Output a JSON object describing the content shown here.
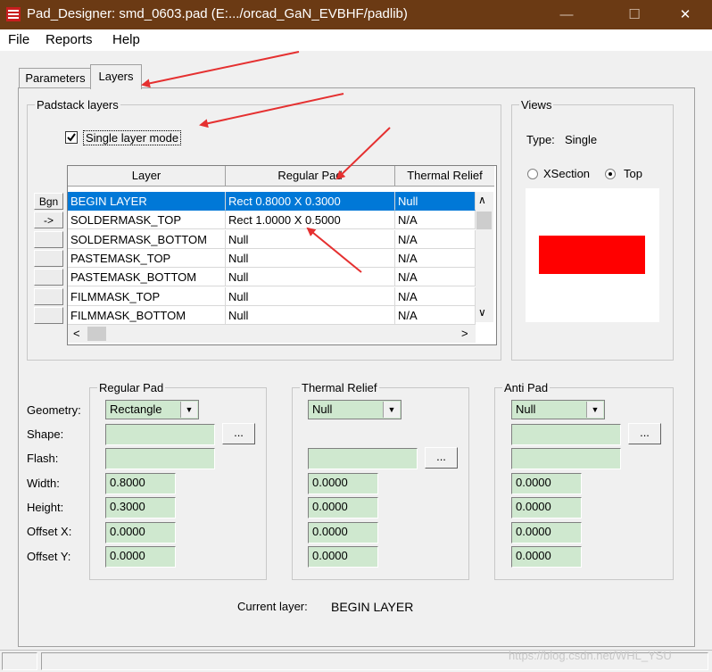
{
  "window": {
    "title": "Pad_Designer: smd_0603.pad (E:.../orcad_GaN_EVBHF/padlib)",
    "minimize": "—",
    "maximize": "☐",
    "close": "✕"
  },
  "menu": [
    "File",
    "Reports",
    "Help"
  ],
  "tabs": [
    "Parameters",
    "Layers"
  ],
  "active_tab": "Layers",
  "padstack": {
    "group_label": "Padstack layers",
    "single_layer_mode_label": "Single layer mode",
    "single_layer_mode_checked": true,
    "columns": [
      "Layer",
      "Regular Pad",
      "Thermal Relief"
    ],
    "rows": [
      {
        "btn": "Bgn",
        "layer": "BEGIN LAYER",
        "regular": "Rect 0.8000 X 0.3000",
        "thermal": "Null",
        "selected": true
      },
      {
        "btn": "->",
        "layer": "SOLDERMASK_TOP",
        "regular": "Rect 1.0000 X 0.5000",
        "thermal": "N/A",
        "selected": false
      },
      {
        "btn": "",
        "layer": "SOLDERMASK_BOTTOM",
        "regular": "Null",
        "thermal": "N/A",
        "selected": false
      },
      {
        "btn": "",
        "layer": "PASTEMASK_TOP",
        "regular": "Null",
        "thermal": "N/A",
        "selected": false
      },
      {
        "btn": "",
        "layer": "PASTEMASK_BOTTOM",
        "regular": "Null",
        "thermal": "N/A",
        "selected": false
      },
      {
        "btn": "",
        "layer": "FILMMASK_TOP",
        "regular": "Null",
        "thermal": "N/A",
        "selected": false
      },
      {
        "btn": "",
        "layer": "FILMMASK_BOTTOM",
        "regular": "Null",
        "thermal": "N/A",
        "selected": false
      }
    ]
  },
  "views": {
    "group_label": "Views",
    "type_label": "Type:",
    "type_value": "Single",
    "options": [
      "XSection",
      "Top"
    ],
    "selected_option": "Top",
    "pad_color": "#ff0000"
  },
  "field_labels": [
    "Geometry:",
    "Shape:",
    "Flash:",
    "Width:",
    "Height:",
    "Offset X:",
    "Offset Y:"
  ],
  "regular_pad": {
    "group_label": "Regular Pad",
    "geometry": "Rectangle",
    "width": "0.8000",
    "height": "0.3000",
    "offset_x": "0.0000",
    "offset_y": "0.0000",
    "browse": "..."
  },
  "thermal_relief": {
    "group_label": "Thermal Relief",
    "geometry": "Null",
    "width": "0.0000",
    "height": "0.0000",
    "offset_x": "0.0000",
    "offset_y": "0.0000",
    "browse": "..."
  },
  "anti_pad": {
    "group_label": "Anti Pad",
    "geometry": "Null",
    "width": "0.0000",
    "height": "0.0000",
    "offset_x": "0.0000",
    "offset_y": "0.0000",
    "browse": "..."
  },
  "current_layer": {
    "label": "Current layer:",
    "value": "BEGIN LAYER"
  },
  "scroll_icons": {
    "up": "∧",
    "down": "∨",
    "left": "<",
    "right": ">",
    "dropdown": "▼"
  },
  "watermark": "https://blog.csdn.net/WHL_YSU",
  "colors": {
    "titlebar": "#6b3a14",
    "selection": "#0078d7",
    "field_green": "#cfe8cf",
    "annotation_arrow": "#e53030"
  }
}
